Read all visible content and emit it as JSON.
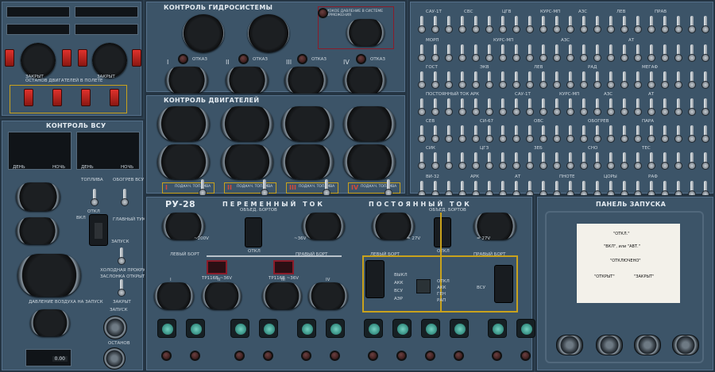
{
  "left_top": {
    "fire_label_1": "ПОЖАРНЫЕ\nПОЖАРНЫЕ КРАНЫ\nОТКРЫТ",
    "fire_label_2": "ПОЖАРНЫЕ\nПОЖАРНЫЕ КРАНЫ\nОТКРЫТ",
    "closed": "ЗАКРЫТ",
    "roman": [
      "I",
      "II",
      "III",
      "IV"
    ],
    "stop_label": "ОСТАНОВ ДВИГАТЕЛЕЙ В ПОЛЕТЕ"
  },
  "apu_panel": {
    "title": "КОНТРОЛЬ ВСУ",
    "day": "ДЕНЬ",
    "night": "НОЧЬ",
    "fuel": "ТОПЛИВА",
    "vsu_fuel": "ОБОГРЕВ ВСУ ВКЛ",
    "main_switch": "ГЛАВНЫЙ ТУМБЛЕР",
    "off": "ОТКЛ",
    "on": "ВКЛ",
    "launch": "ЗАПУСК",
    "cold": "ХОЛОДНАЯ ПРОКРУТКА",
    "flap": "ЗАСЛОНКА ОТКРЫТА",
    "closed": "ЗАКРЫТ",
    "air_pressure": "ДАВЛЕНИЕ ВОЗДУХА НА ЗАПУСК",
    "stop": "ОСТАНОВ",
    "launch2": "ЗАПУСК",
    "display_value": "0.00"
  },
  "hydraulics": {
    "title": "КОНТРОЛЬ ГИДРОСИСТЕМЫ",
    "emergency_label": "НИЗКОЕ ДАВЛЕНИЕ В СИСТЕМЕ ТОРМОЖЕНИЯ",
    "engines": [
      "I",
      "II",
      "III",
      "IV"
    ],
    "fail": "ОТКАЗ",
    "x10": "x10"
  },
  "engines": {
    "title": "КОНТРОЛЬ ДВИГАТЕЛЕЙ",
    "pump_label": "ПОДКАЧ. ТОПЛИВА",
    "roman": [
      "I",
      "II",
      "III",
      "IV"
    ]
  },
  "switch_panel": {
    "row_labels": [
      "ПЕРЕМЕННЫЙ ТОК",
      "",
      "ПОСТОЯННЫЙ ТОК",
      "",
      "",
      "",
      ""
    ],
    "tags_row1": [
      "САУ-1Т",
      "СВС",
      "ЦГВ",
      "КУРС-МП",
      "АЗС",
      "ЛЕВ",
      "ПРАВ"
    ],
    "tags_row2": [
      "МОРП",
      "КУРС-МП",
      "АЗС",
      "АТ"
    ],
    "tags_row3": [
      "ГОСТ",
      "ЭКВ",
      "ЛЕВ",
      "РАД",
      "МЕГАФ"
    ],
    "tags_row4": [
      "ПОСТОЯННЫЙ ТОК",
      "АРК",
      "САУ-1Т",
      "КУРС-МП",
      "АЗС",
      "АТ"
    ],
    "tags_row5": [
      "СЕВ",
      "СИ-67",
      "ОВС",
      "ОБОГРЕВ",
      "ПАРА"
    ],
    "tags_row6": [
      "СИК",
      "ЦГЗ",
      "ЗЕБ",
      "СНО",
      "ТЕС"
    ],
    "tags_row7": [
      "ВИ-32",
      "АРК",
      "АТ",
      "ПНОТЕ",
      "ЦОРЫ",
      "РАФ"
    ]
  },
  "ru28": {
    "title": "РУ-28",
    "ac_title": "ПЕРЕМЕННЫЙ ТОК",
    "dc_title": "ПОСТОЯННЫЙ ТОК",
    "merge_ac": "ОБЪЕД. БОРТОВ",
    "merge_dc": "ОБЪЕД. БОРТОВ",
    "left_board": "ЛЕВЫЙ БОРТ",
    "right_board": "ПРАВЫЙ БОРТ",
    "left_board_dc": "ЛЕВЫЙ БОРТ",
    "right_board_dc": "ПРАВЫЙ БОРТ",
    "v200": "~200V",
    "v36": "~36V",
    "v27": "= 27V",
    "v27b": "= 27V",
    "off": "ОТКЛ",
    "tr_left": "ТР116В ~36V",
    "tr_right": "ТР116В ~36V",
    "roman": [
      "I",
      "II",
      "III",
      "IV"
    ],
    "vol": "ВЫКЛ",
    "akk": "АКК",
    "vsu": "ВСУ",
    "aer": "АЭР",
    "off2": "ОТКЛ",
    "akk2": "АКК",
    "gen": "ГЕН",
    "rap": "РАП",
    "vsu2": "ВСУ",
    "bottom": [
      "1",
      "2",
      "ВСУ",
      "РАП",
      "3",
      "4",
      "1",
      "2",
      "ВСУ",
      "РАП",
      "ГАП",
      "ОТКЛ",
      "1",
      "2",
      "3",
      "4"
    ]
  },
  "launch": {
    "title": "ПАНЕЛЬ ЗАПУСКА",
    "rows": [
      "\"ОТКЛ.\"",
      "\"ВКЛ\", или \"АВТ.\"",
      "\"ОТКЛЮЧЕНО\"",
      "\"ОТКРЫТ\"",
      "\"ЗАКРЫТ\""
    ]
  },
  "colors": {
    "panel": "#3c5468",
    "bg": "#2c3e4e",
    "accent": "#c9a21c",
    "red": "#d22a24"
  }
}
